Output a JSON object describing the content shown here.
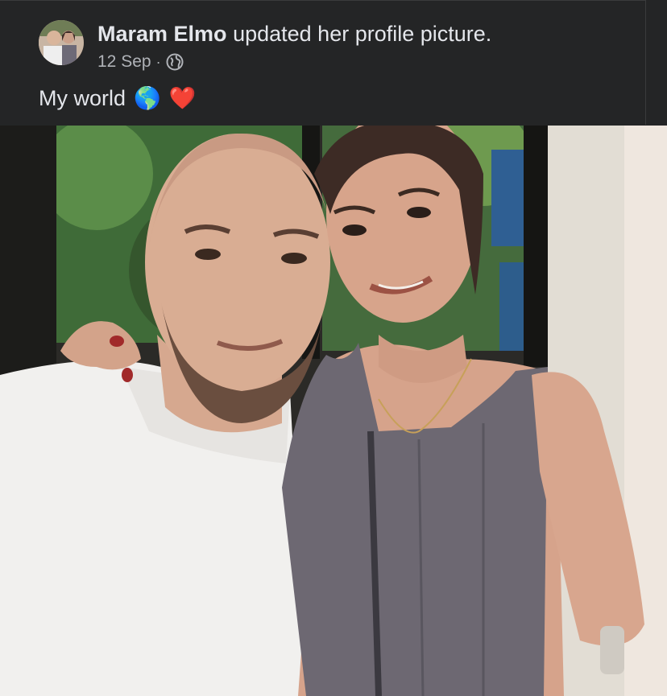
{
  "post": {
    "author": "Maram Elmo",
    "action": "updated her profile picture.",
    "date": "12 Sep",
    "separator": "·",
    "audience_icon": "globe-icon",
    "caption_text": "My world",
    "caption_emojis": [
      "🌎",
      "❤️"
    ]
  },
  "colors": {
    "background": "#242526",
    "primary_text": "#e4e6eb",
    "secondary_text": "#b0b3b8"
  }
}
